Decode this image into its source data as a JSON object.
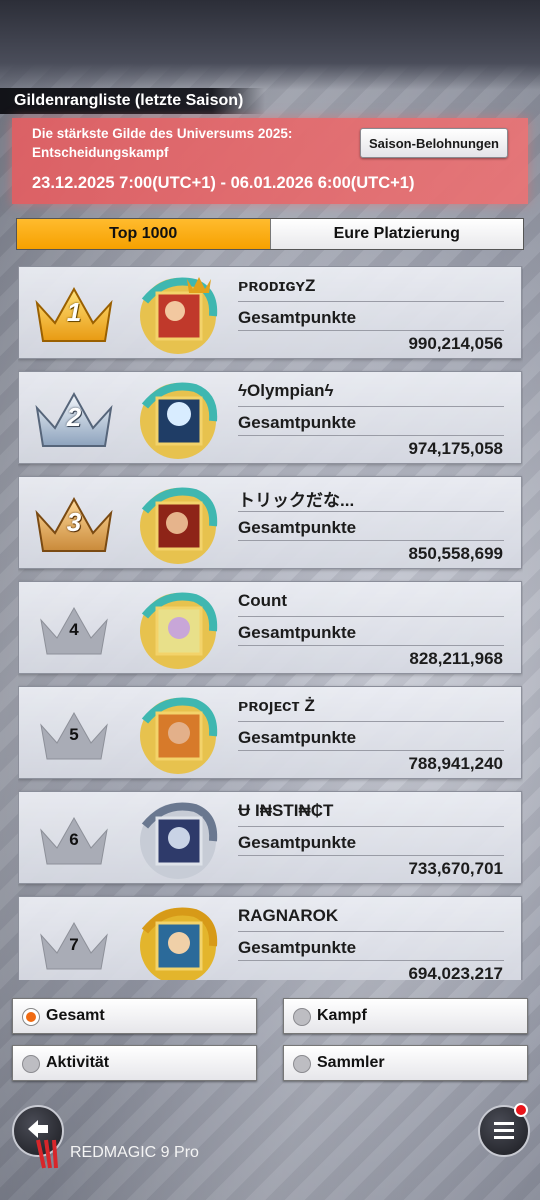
{
  "header": {
    "section_title": "Gildenrangliste (letzte Saison)"
  },
  "event": {
    "title": "Die stärkste Gilde des Universums 2025: Entscheidungskampf",
    "dates": "23.12.2025 7:00(UTC+1) - 06.01.2026 6:00(UTC+1)",
    "rewards_button": "Saison-Belohnungen"
  },
  "tabs": [
    {
      "label": "Top 1000",
      "active": true
    },
    {
      "label": "Eure Platzierung",
      "active": false
    }
  ],
  "rankings": [
    {
      "rank": "1",
      "name": "ᴘʀᴏᴅɪɢʏZ",
      "points_label": "Gesamtpunkte",
      "points": "990,214,056",
      "crown": "gold"
    },
    {
      "rank": "2",
      "name": "ϟOlympianϟ",
      "points_label": "Gesamtpunkte",
      "points": "974,175,058",
      "crown": "silver"
    },
    {
      "rank": "3",
      "name": "トリックだな...",
      "points_label": "Gesamtpunkte",
      "points": "850,558,699",
      "crown": "bronze"
    },
    {
      "rank": "4",
      "name": "Count",
      "points_label": "Gesamtpunkte",
      "points": "828,211,968",
      "crown": "plain"
    },
    {
      "rank": "5",
      "name": "ᴘʀᴏȷᴇᴄᴛ Ż",
      "points_label": "Gesamtpunkte",
      "points": "788,941,240",
      "crown": "plain"
    },
    {
      "rank": "6",
      "name": "Ʉ I₦STI₦₵T",
      "points_label": "Gesamtpunkte",
      "points": "733,670,701",
      "crown": "plain"
    },
    {
      "rank": "7",
      "name": "RAGNAROK",
      "points_label": "Gesamtpunkte",
      "points": "694,023,217",
      "crown": "plain"
    }
  ],
  "filters": [
    {
      "label": "Gesamt",
      "checked": true
    },
    {
      "label": "Kampf",
      "checked": false
    },
    {
      "label": "Aktivität",
      "checked": false
    },
    {
      "label": "Sammler",
      "checked": false
    }
  ],
  "footer": {
    "device_label": "REDMAGIC 9 Pro",
    "back_icon": "back-arrow-icon",
    "menu_icon": "hamburger-menu-icon"
  },
  "colors": {
    "tab_active": "#f6a100",
    "banner": "#e07478",
    "radio_selected": "#f06a12",
    "notification": "#e8141a"
  }
}
